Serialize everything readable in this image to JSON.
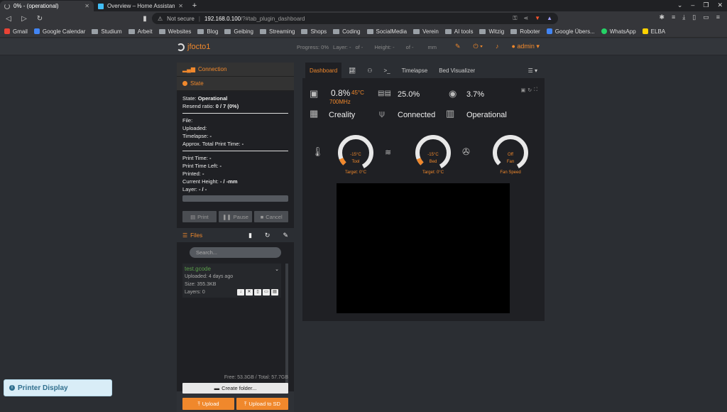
{
  "browser": {
    "tabs": [
      {
        "title": "0% - (operational)",
        "active": true,
        "icon": "spinner-icon"
      },
      {
        "title": "Overview – Home Assistant",
        "active": false,
        "icon": "home-assistant-icon"
      }
    ],
    "new_tab": "+",
    "address": {
      "security": "Not secure",
      "host": "192.168.0.100",
      "path": "/?#tab_plugin_dashboard"
    },
    "bookmarks": [
      {
        "label": "Gmail",
        "icon": "gmail-icon"
      },
      {
        "label": "Google Calendar",
        "icon": "calendar-icon"
      },
      {
        "label": "Studium",
        "icon": "folder-icon"
      },
      {
        "label": "Arbeit",
        "icon": "folder-icon"
      },
      {
        "label": "Websites",
        "icon": "folder-icon"
      },
      {
        "label": "Blog",
        "icon": "folder-icon"
      },
      {
        "label": "Geibing",
        "icon": "folder-icon"
      },
      {
        "label": "Streaming",
        "icon": "folder-icon"
      },
      {
        "label": "Shops",
        "icon": "folder-icon"
      },
      {
        "label": "Coding",
        "icon": "folder-icon"
      },
      {
        "label": "SocialMedia",
        "icon": "folder-icon"
      },
      {
        "label": "Verein",
        "icon": "folder-icon"
      },
      {
        "label": "AI tools",
        "icon": "folder-icon"
      },
      {
        "label": "Witzig",
        "icon": "folder-icon"
      },
      {
        "label": "Roboter",
        "icon": "folder-icon"
      },
      {
        "label": "Google Übers...",
        "icon": "translate-icon"
      },
      {
        "label": "WhatsApp",
        "icon": "whatsapp-icon"
      },
      {
        "label": "ELBA",
        "icon": "elba-icon"
      }
    ]
  },
  "navbar": {
    "brand": "jfocto1",
    "progress": "Progress: 0%",
    "layer_label": "Layer: -",
    "layer_of": "of -",
    "height_label": "Height: -",
    "height_of": "of -",
    "height_unit": "mm",
    "user": "admin"
  },
  "left": {
    "connection_title": "Connection",
    "state_title": "State",
    "state": {
      "state_label": "State:",
      "state_value": "Operational",
      "resend_label": "Resend ratio:",
      "resend_value": "0 / 7 (0%)",
      "file": "File:",
      "uploaded": "Uploaded:",
      "timelapse_label": "Timelapse:",
      "timelapse_value": "-",
      "approx_label": "Approx. Total Print Time:",
      "approx_value": "-",
      "print_time_label": "Print Time:",
      "print_time_value": "-",
      "print_left_label": "Print Time Left:",
      "print_left_value": "-",
      "printed_label": "Printed:",
      "printed_value": "-",
      "height_label": "Current Height:",
      "height_value": "- / -mm",
      "layer_label": "Layer:",
      "layer_value": "- / -"
    },
    "buttons": {
      "print": "Print",
      "pause": "Pause",
      "cancel": "Cancel"
    },
    "files_title": "Files",
    "search_placeholder": "Search...",
    "file": {
      "name": "test.gcode",
      "uploaded": "Uploaded: 4 days ago",
      "size": "Size: 355.3KB",
      "layers": "Layers: 0"
    },
    "free": "Free: 53.3GB / Total: 57.7GB",
    "create_folder": "Create folder...",
    "upload": "Upload",
    "upload_sd": "Upload to SD"
  },
  "right": {
    "tabs": [
      "Dashboard",
      "Timelapse",
      "Bed Visualizer"
    ],
    "cpu_load": "0.8%",
    "cpu_temp": "45°C",
    "cpu_freq": "700MHz",
    "ram": "25.0%",
    "disk": "3.7%",
    "printer_name": "Creality",
    "connection": "Connected",
    "status": "Operational",
    "gauges": [
      {
        "value": "-15°C",
        "label": "Tool",
        "caption": "Target: 0°C",
        "fraction": 0.08
      },
      {
        "value": "-15°C",
        "label": "Bed",
        "caption": "Target: 0°C",
        "fraction": 0.08
      },
      {
        "value": "Off",
        "label": "Fan",
        "caption": "Fan Speed",
        "fraction": 0
      }
    ]
  },
  "printer_display": "Printer Display"
}
